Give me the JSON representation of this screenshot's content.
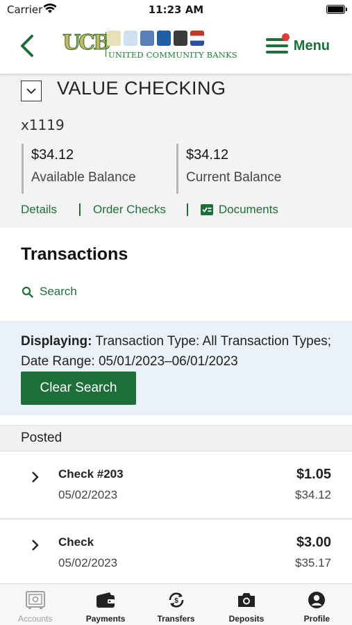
{
  "status_bar": {
    "carrier": "Carrier",
    "time": "11:23 AM"
  },
  "header": {
    "logo_mark": "UCB",
    "logo_name": "UNITED COMMUNITY BANKS",
    "menu_label": "Menu"
  },
  "account": {
    "title": "VALUE CHECKING",
    "number": "x1119",
    "available_amount": "$34.12",
    "available_label": "Available Balance",
    "current_amount": "$34.12",
    "current_label": "Current Balance",
    "links": {
      "details": "Details",
      "order_checks": "Order Checks",
      "documents": "Documents"
    }
  },
  "transactions": {
    "title": "Transactions",
    "search_label": "Search",
    "filter_prefix": "Displaying:",
    "filter_text": "Transaction Type: All Transaction Types; Date Range: 05/01/2023–06/01/2023",
    "clear_label": "Clear Search",
    "section_label": "Posted",
    "items": [
      {
        "description": "Check #203",
        "date": "05/02/2023",
        "amount": "$1.05",
        "balance": "$34.12"
      },
      {
        "description": "Check",
        "date": "05/02/2023",
        "amount": "$3.00",
        "balance": "$35.17"
      }
    ]
  },
  "tabbar": {
    "items": [
      {
        "label": "Accounts",
        "icon": "safe-icon",
        "active": true
      },
      {
        "label": "Payments",
        "icon": "wallet-icon",
        "active": false
      },
      {
        "label": "Transfers",
        "icon": "transfer-icon",
        "active": false
      },
      {
        "label": "Deposits",
        "icon": "camera-icon",
        "active": false
      },
      {
        "label": "Profile",
        "icon": "profile-icon",
        "active": false
      }
    ]
  },
  "colors": {
    "brand_green": "#1e6e3a",
    "notification_red": "#e23a3a",
    "filter_bg": "#eaf1f8"
  }
}
